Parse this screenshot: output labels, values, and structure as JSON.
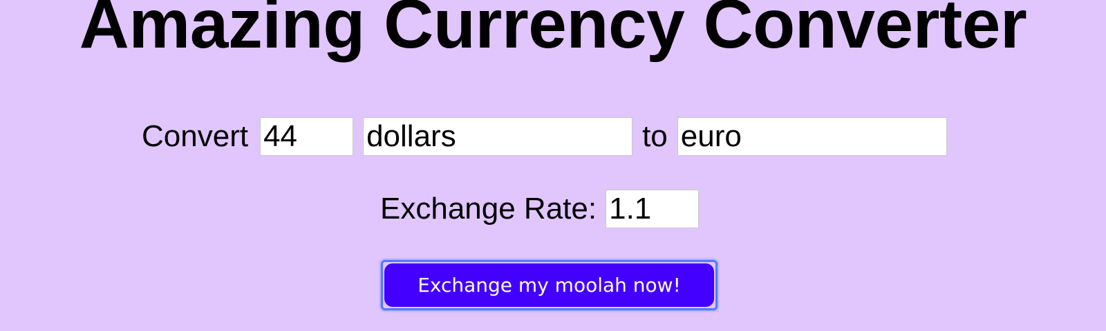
{
  "page": {
    "title": "Amazing Currency Converter",
    "background_color": "#e1c6fd"
  },
  "converter": {
    "convert_label": "Convert",
    "amount_value": "44",
    "from_currency_value": "dollars",
    "to_label": "to",
    "to_currency_value": "euro",
    "rate_label": "Exchange Rate:",
    "rate_value": "1.1"
  },
  "submit": {
    "label": "Exchange my moolah now!",
    "color": "#4400ff",
    "focus_ring_color": "#4e7bff"
  }
}
